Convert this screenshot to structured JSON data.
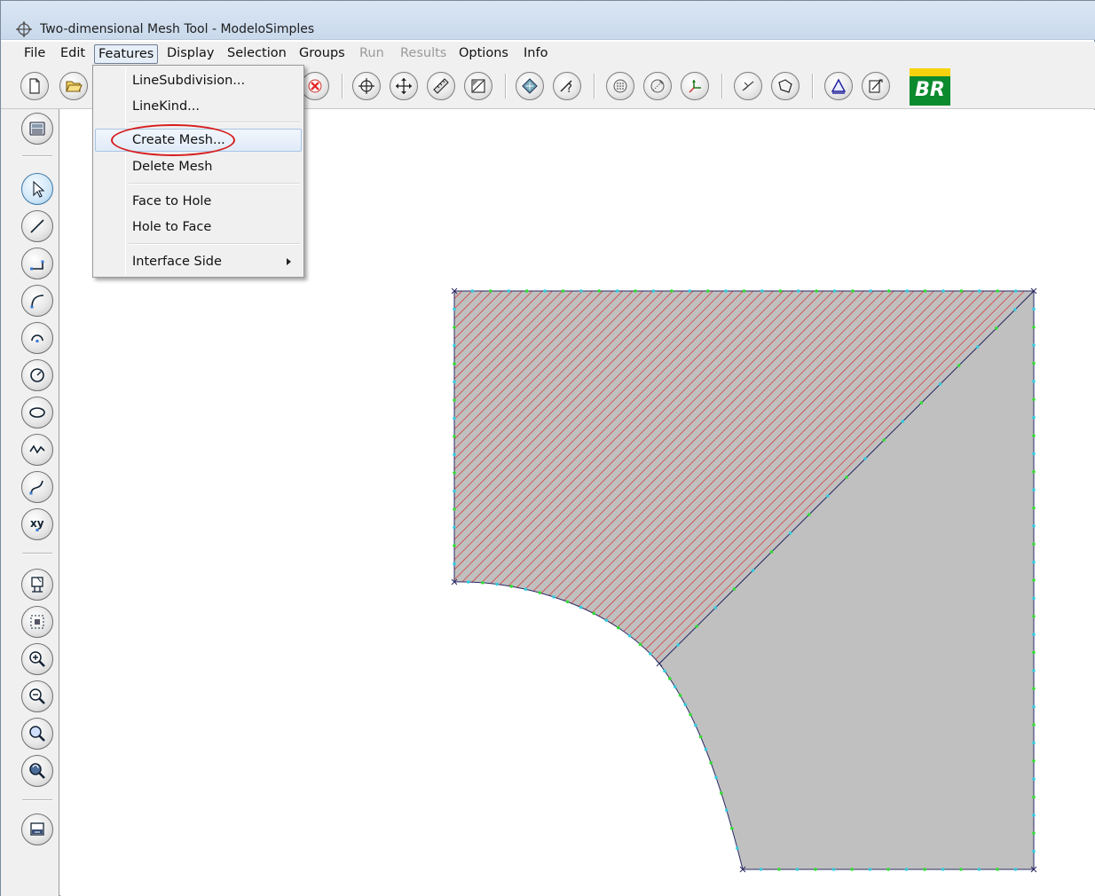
{
  "window": {
    "title": "Two-dimensional Mesh Tool - ModeloSimples",
    "icon": "mesh-tool-icon"
  },
  "menubar": [
    {
      "label": "File",
      "enabled": true
    },
    {
      "label": "Edit",
      "enabled": true
    },
    {
      "label": "Features",
      "enabled": true,
      "active": true
    },
    {
      "label": "Display",
      "enabled": true
    },
    {
      "label": "Selection",
      "enabled": true
    },
    {
      "label": "Groups",
      "enabled": true
    },
    {
      "label": "Run",
      "enabled": false
    },
    {
      "label": "Results",
      "enabled": false
    },
    {
      "label": "Options",
      "enabled": true
    },
    {
      "label": "Info",
      "enabled": true
    }
  ],
  "features_menu": {
    "items": [
      {
        "label": "LineSubdivision..."
      },
      {
        "label": "LineKind..."
      },
      {
        "label": "Create Mesh...",
        "highlighted": true,
        "annotated": true
      },
      {
        "label": "Delete Mesh"
      },
      {
        "label": "Face to Hole"
      },
      {
        "label": "Hole to Face"
      },
      {
        "label": "Interface Side",
        "submenu": true
      }
    ]
  },
  "toolbar": {
    "buttons": [
      "new-file-icon",
      "open-folder-icon",
      "delete-icon",
      "move-icon",
      "pan-icon",
      "measure-icon",
      "edit-icon",
      "mesh-icon",
      "query-icon",
      "grid-icon",
      "snap-icon",
      "axes-icon",
      "edge-icon",
      "region-icon",
      "triangle-icon",
      "properties-icon"
    ],
    "logo": "BR"
  },
  "left_toolbar": {
    "buttons": [
      "keyboard-icon",
      "select-arrow-icon",
      "line-icon",
      "polyline-icon",
      "arc-icon",
      "circle-arc-icon",
      "circle-icon",
      "ellipse-icon",
      "polygon-icon",
      "curve-icon",
      "xy-point-icon",
      "zoom-window-icon",
      "fit-icon",
      "zoom-in-icon",
      "zoom-out-icon",
      "zoom-icon",
      "zoom-previous-icon",
      "display-icon"
    ],
    "xy_label": "xy",
    "selected": "select-arrow-icon"
  },
  "colors": {
    "hatched_region_fill": "#c0c0c0",
    "hatch_lines": "#d92020",
    "meshed_region_fill": "#c0c0c0",
    "boundary": "#2a2a66",
    "node_green": "#33dd33",
    "node_cyan": "#33ccdd",
    "vertex_mark": "#2a2a66",
    "annotation": "#d61e1e"
  }
}
